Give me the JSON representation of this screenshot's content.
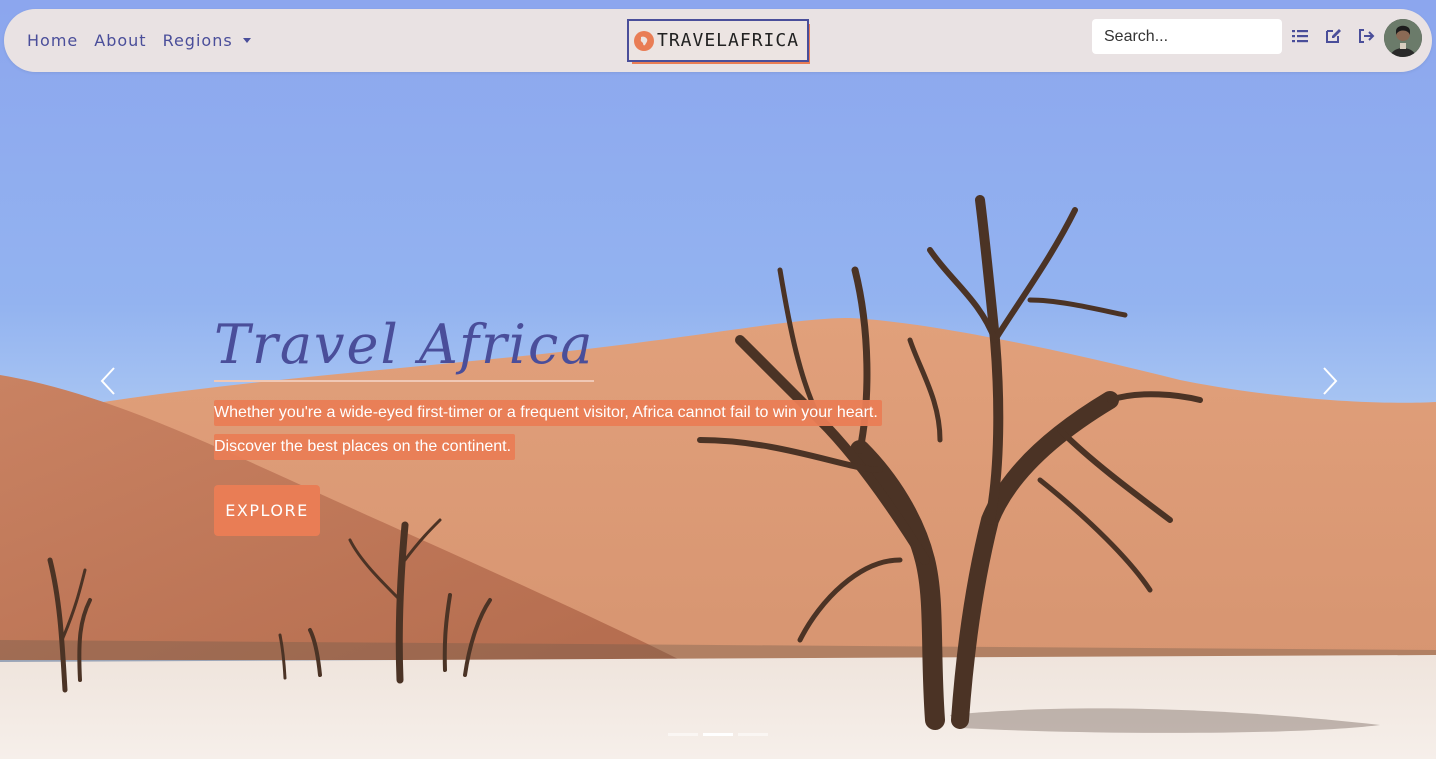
{
  "nav": {
    "links": [
      "Home",
      "About",
      "Regions"
    ],
    "brand": "TRAVELAFRICA",
    "search_placeholder": "Search..."
  },
  "icons": {
    "list": "list-icon",
    "edit": "edit-icon",
    "logout": "logout-icon",
    "avatar": "user-avatar",
    "brand": "africa-globe-icon",
    "prev": "chevron-left-icon",
    "next": "chevron-right-icon"
  },
  "hero": {
    "title": "Travel Africa",
    "line1": "Whether you're a wide-eyed first-timer or a frequent visitor, Africa cannot fail to win your heart.",
    "line2": "Discover the best places on the continent.",
    "button": "EXPLORE"
  },
  "colors": {
    "accent": "#e97d55",
    "primary": "#4a4e9a",
    "navbar": "#ece4e2"
  }
}
